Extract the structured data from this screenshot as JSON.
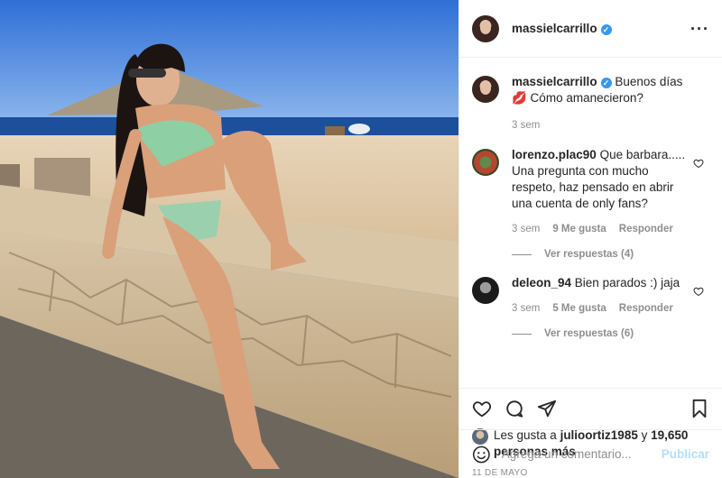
{
  "post": {
    "username": "massielcarrillo",
    "verified_mark": "✓",
    "more_label": "···"
  },
  "caption": {
    "username": "massielcarrillo",
    "text": "Buenos días 💋 Cómo amanecieron?",
    "time": "3 sem"
  },
  "comments": [
    {
      "username": "lorenzo.plac90",
      "text": "Que barbara..... Una pregunta con mucho respeto, haz pensado en abrir una cuenta de only fans?",
      "time": "3 sem",
      "likes": "9 Me gusta",
      "reply": "Responder",
      "view_replies": "Ver respuestas (4)"
    },
    {
      "username": "deleon_94",
      "text": "Bien parados :) jaja",
      "time": "3 sem",
      "likes": "5 Me gusta",
      "reply": "Responder",
      "view_replies": "Ver respuestas (6)"
    }
  ],
  "likes": {
    "prefix": "Les gusta a ",
    "user": "julioortiz1985",
    "mid": " y ",
    "count": "19,650 personas más"
  },
  "date": "11 DE MAYO",
  "add_comment": {
    "placeholder": "Agrega un comentario...",
    "publish": "Publicar"
  },
  "icons": {
    "like": "heart-icon",
    "comment": "comment-icon",
    "share": "share-icon",
    "save": "bookmark-icon",
    "emoji": "emoji-icon",
    "more": "more-icon"
  },
  "colors": {
    "verified": "#3897f0",
    "publish_disabled": "#b2dffc",
    "muted": "#8e8e8e"
  }
}
